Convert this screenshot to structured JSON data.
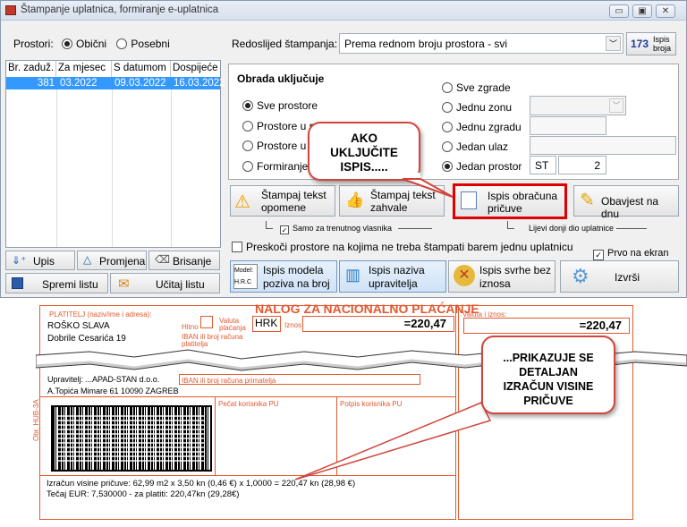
{
  "window": {
    "title": "Štampanje uplatnica, formiranje e-uplatnica",
    "min": "▭",
    "max": "▣",
    "close": "✕"
  },
  "prostori": {
    "label": "Prostori:",
    "opt1": "Obični",
    "opt2": "Posebni"
  },
  "table": {
    "headers": [
      "Br. zaduž.",
      "Za mjesec",
      "S datumom",
      "Dospijeće"
    ],
    "row": [
      "381",
      "03.2022",
      "09.03.2022",
      "16.03.2022"
    ]
  },
  "left_buttons": {
    "upis": "Upis",
    "promjena": "Promjena",
    "brisanje": "Brisanje",
    "spremi": "Spremi listu",
    "ucitaj": "Učitaj listu"
  },
  "redoslijed": {
    "label": "Redoslijed štampanja:",
    "value": "Prema rednom broju prostora - svi",
    "ispis_broja_num": "173",
    "ispis_broja": "Ispis broja"
  },
  "obrada": {
    "title": "Obrada uključuje",
    "left": [
      "Sve prostore",
      "Prostore u pri",
      "Prostore u v",
      "Formiranje e"
    ],
    "right": [
      "Sve zgrade",
      "Jednu zonu",
      "Jednu zgradu",
      "Jedan ulaz",
      "Jedan prostor"
    ],
    "prostor_code": "ST",
    "prostor_num": "2"
  },
  "stampaj_opomene": "Štampaj tekst opomene",
  "stampaj_zahvale": "Štampaj tekst zahvale",
  "ispis_obracuna": "Ispis obračuna pričuve",
  "obavjest": "Obavjest na dnu",
  "samo_vlasnika": "Samo za trenutnog vlasnika",
  "lijevi_donji": "Lijevi donji dio uplatnice",
  "preskoci": "Preskoči prostore na kojima ne treba štampati barem jednu uplatnicu",
  "prvo_ekran": "Prvo na ekran",
  "ispis_modela_icon": "Model: H.R.C",
  "ispis_modela": "Ispis modela poziva na broj",
  "ispis_naziva": "Ispis naziva upravitelja",
  "ispis_svrhe": "Ispis svrhe bez iznosa",
  "izvrsi": "Izvrši",
  "callout1": "AKO UKLJUČITE ISPIS.....",
  "callout2": "...PRIKAZUJE SE DETALJAN IZRAČUN VISINE PRIČUVE",
  "nalog": {
    "title": "NALOG ZA NACIONALNO PLAĆANJE",
    "platitelj_label": "PLATITELJ (naziv/ime i adresa):",
    "platitelj_name": "ROŠKO SLAVA",
    "platitelj_addr": "Dobrile Cesarića 19",
    "hitno": "Hitno",
    "valuta_label": "Valuta plaćanja",
    "valuta": "HRK",
    "iznos_label": "Iznos",
    "iznos": "=220,47",
    "iban_label": "IBAN ili broj računa platitelja",
    "primatelj": "Upravitelj: ...APAD-STAN d.o.o.",
    "primatelj_addr": "A.Topića Mimare 61 10090 ZAGREB",
    "iban_prim_label": "IBAN ili broj računa primatelja",
    "potpis1": "Pečat korisnika PU",
    "potpis2": "Potpis korisnika PU",
    "side_label": "Valuta i iznos:",
    "side_iznos": "=220,47",
    "vertical": "Obr. HUB-3A",
    "izracun": "Izračun visine pričuve: 62,99 m2 x 3,50 kn (0,46 €) x 1,0000 = 220,47 kn (28,98 €)",
    "tecaj": "Tečaj EUR: 7,530000 - za platiti: 220,47kn (29,28€)"
  },
  "colors": {
    "orange": "#e2592f",
    "selection": "#3399ff",
    "highlight": "#e00000"
  }
}
